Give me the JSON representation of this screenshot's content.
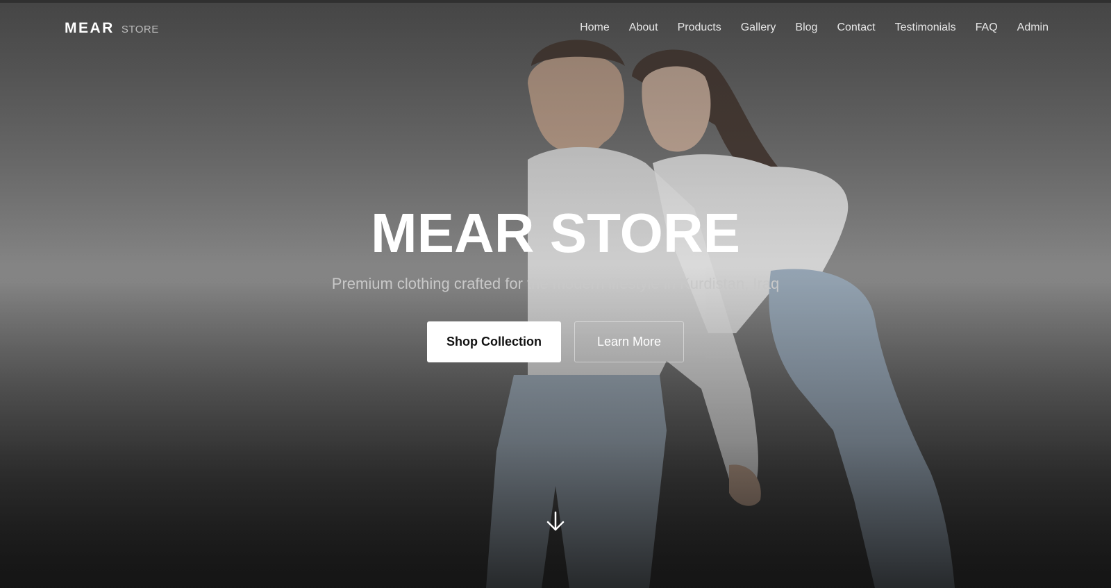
{
  "brand": {
    "name": "MEAR",
    "suffix": "STORE"
  },
  "nav": {
    "items": [
      "Home",
      "About",
      "Products",
      "Gallery",
      "Blog",
      "Contact",
      "Testimonials",
      "FAQ",
      "Admin"
    ]
  },
  "hero": {
    "title": "MEAR STORE",
    "subtitle": "Premium clothing crafted for the modern lifestyle in Kurdistan, Iraq",
    "primary_cta": "Shop Collection",
    "secondary_cta": "Learn More",
    "scroll_icon": "arrow-down-icon"
  },
  "colors": {
    "primary_button_bg": "#ffffff",
    "text_light": "#ffffff",
    "subtitle_text": "#c8c8c8"
  }
}
